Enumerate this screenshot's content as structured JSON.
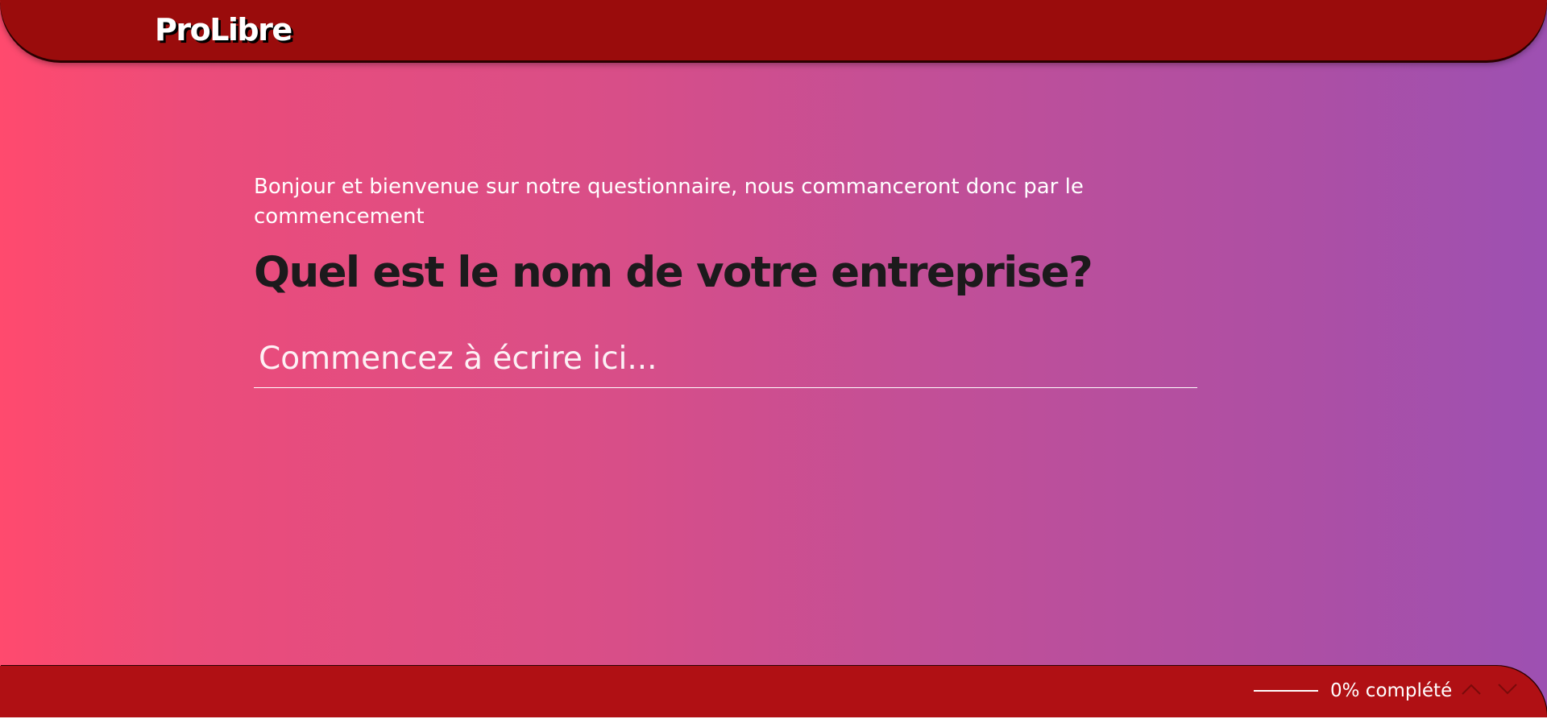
{
  "brand": {
    "name": "ProLibre"
  },
  "survey": {
    "intro_text": "Bonjour et bienvenue sur notre questionnaire, nous commanceront donc par le commencement",
    "question": "Quel est le nom de votre entreprise?",
    "answer_value": "",
    "answer_placeholder": "Commencez à écrire ici..."
  },
  "footer": {
    "progress_percent": 0,
    "progress_label": "0% complété",
    "prev_icon": "chevron-up-icon",
    "next_icon": "chevron-down-icon"
  },
  "colors": {
    "header_bg": "#9a0c0c",
    "footer_bg": "#b01014",
    "gradient_start": "#ff4a6e",
    "gradient_end": "#9d50b2",
    "question_text": "#1c1a1c"
  }
}
